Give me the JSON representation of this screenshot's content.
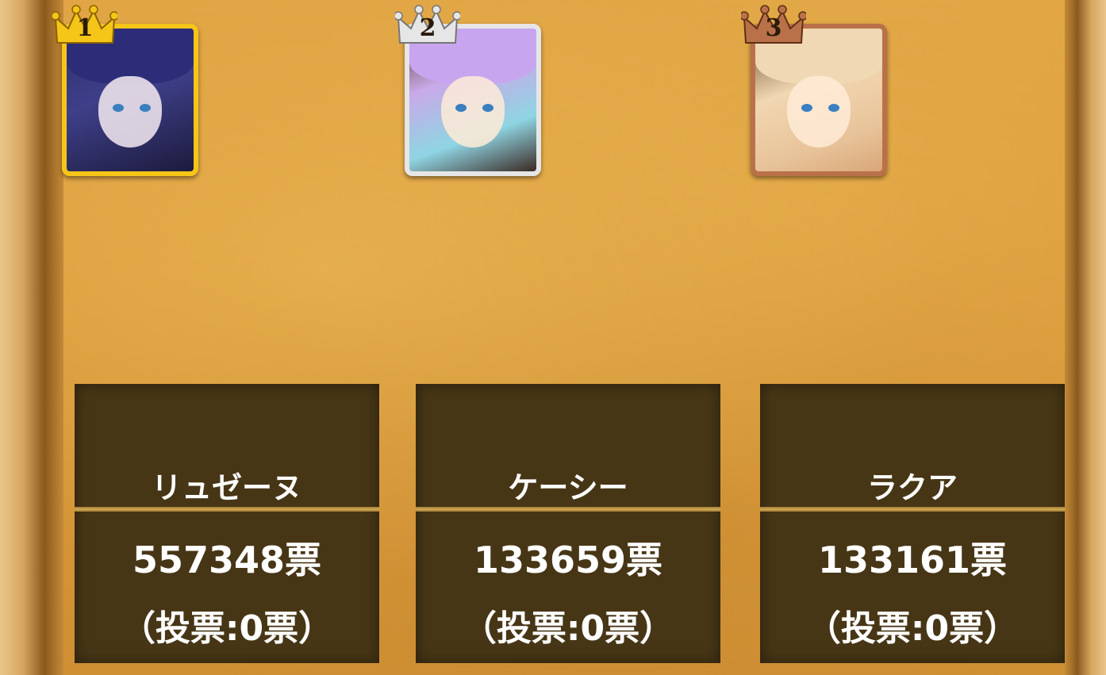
{
  "ranking": [
    {
      "rank": "1",
      "name": "リュゼーヌ",
      "votes": "557348票",
      "my_votes": "（投票:0票）",
      "frame": "gold",
      "crown_color": "#f5c518"
    },
    {
      "rank": "2",
      "name": "ケーシー",
      "votes": "133659票",
      "my_votes": "（投票:0票）",
      "frame": "silver",
      "crown_color": "#e6e6e6"
    },
    {
      "rank": "3",
      "name": "ラクア",
      "votes": "133161票",
      "my_votes": "（投票:0票）",
      "frame": "bronze",
      "crown_color": "#b9714a"
    }
  ]
}
